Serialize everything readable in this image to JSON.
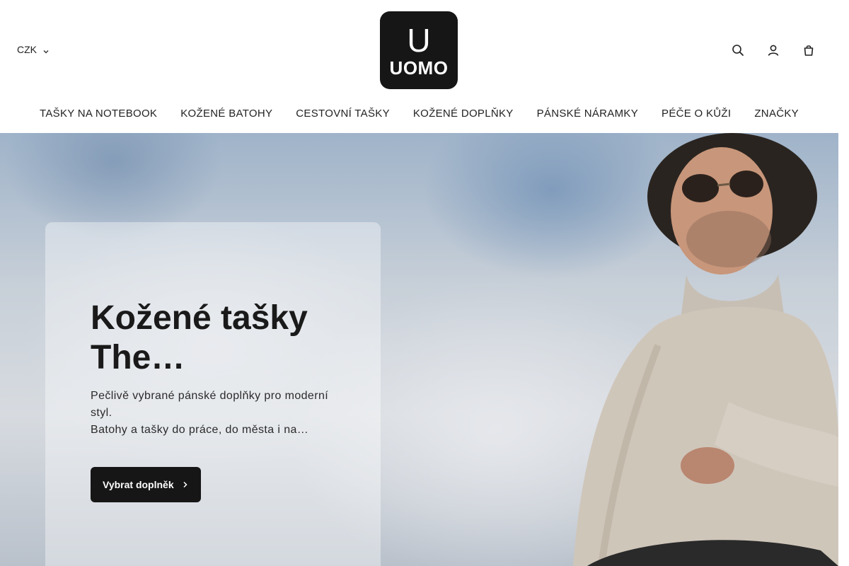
{
  "header": {
    "currency": "CZK",
    "logo": {
      "letter": "U",
      "word": "UOMO"
    },
    "icons": [
      "search-icon",
      "user-icon",
      "cart-icon"
    ]
  },
  "nav": {
    "items": [
      "TAŠKY NA NOTEBOOK",
      "KOŽENÉ BATOHY",
      "CESTOVNÍ TAŠKY",
      "KOŽENÉ DOPLŇKY",
      "PÁNSKÉ NÁRAMKY",
      "PÉČE O KŮŽI",
      "ZNAČKY"
    ]
  },
  "hero": {
    "headline": "Kožené tašky The…",
    "description_line1": "Pečlivě vybrané pánské doplňky pro moderní styl.",
    "description_line2": "Batohy a tašky do práce, do města i na…",
    "cta_label": "Vybrat doplněk"
  }
}
